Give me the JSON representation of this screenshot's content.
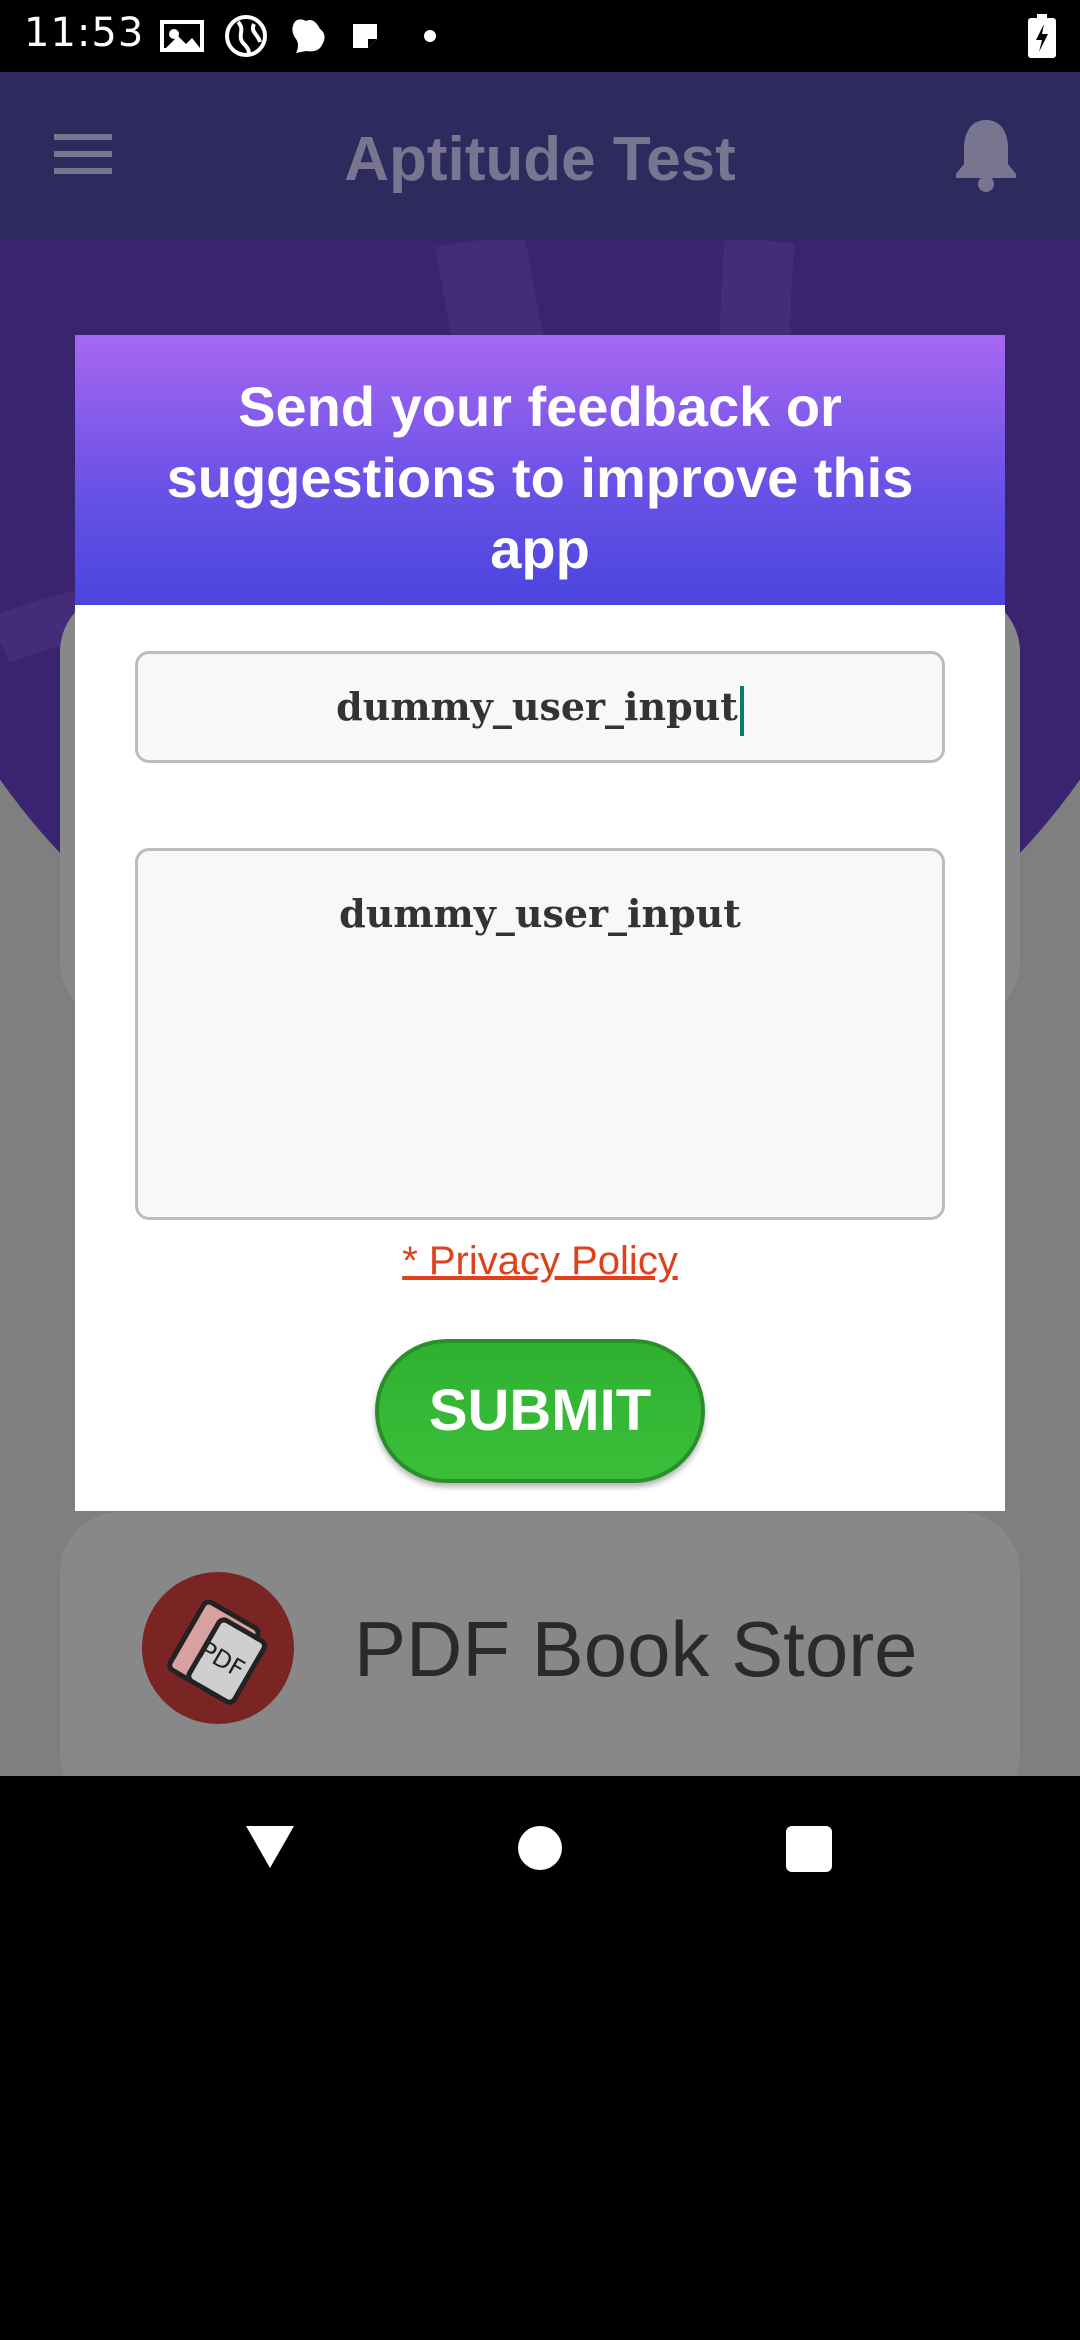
{
  "status_bar": {
    "time": "11:53",
    "icons": [
      "photo-icon",
      "globe-icon",
      "notification-icon",
      "note-icon",
      "dot-icon"
    ],
    "battery": "battery-charging-icon"
  },
  "app": {
    "title": "Aptitude Test",
    "menu_icon": "menu-icon",
    "bell_icon": "bell-icon",
    "list_item_label": "PDF Book Store",
    "list_item_icon_text": "PDF"
  },
  "dialog": {
    "title": "Send your feedback or suggestions to improve this app",
    "subject_value": "dummy_user_input",
    "message_value": "dummy_user_input",
    "privacy_link": "* Privacy Policy",
    "submit_label": "SUBMIT"
  },
  "colors": {
    "header_top": "#a767f2",
    "header_bottom": "#4a45de",
    "submit": "#3bbf3b",
    "privacy": "#e0401a"
  }
}
